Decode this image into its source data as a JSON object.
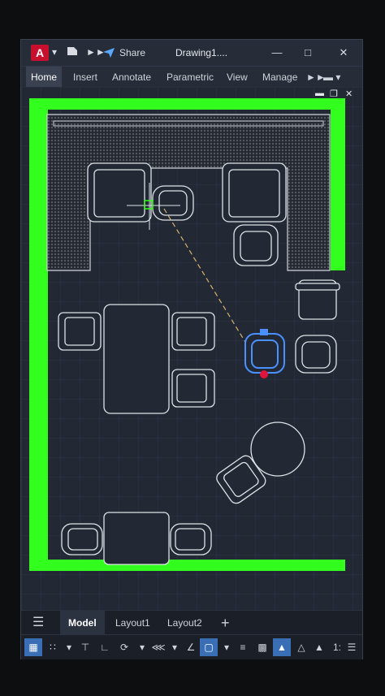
{
  "app": {
    "logo": "A",
    "share_label": "Share",
    "title": "Drawing1...."
  },
  "icons": {
    "logo": "autocad-logo-icon",
    "menu_caret": "caret-down-icon",
    "file": "file-icon",
    "more": "double-chevron-right-icon",
    "share": "paper-plane-icon",
    "minimize": "minimize-icon",
    "maximize": "maximize-icon",
    "close": "close-icon"
  },
  "ribbon": {
    "tabs": [
      "Home",
      "Insert",
      "Annotate",
      "Parametric",
      "View",
      "Manage"
    ],
    "active": "Home"
  },
  "layout_tabs": {
    "items": [
      "Model",
      "Layout1",
      "Layout2"
    ],
    "add_label": "+",
    "active": "Model"
  },
  "status": {
    "scale": "1:"
  },
  "colors": {
    "accent": "#3a6fb5",
    "wall_green": "#33ff1e",
    "selection_blue": "#4a90ff",
    "grip_red": "#e0143c",
    "brand": "#c8102e"
  }
}
